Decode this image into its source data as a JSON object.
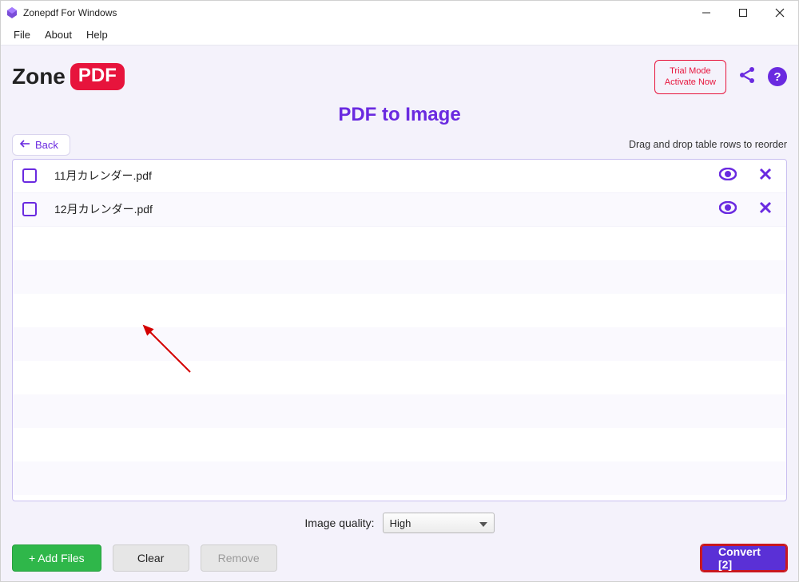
{
  "window": {
    "title": "Zonepdf For Windows"
  },
  "menubar": {
    "file": "File",
    "about": "About",
    "help": "Help"
  },
  "logo": {
    "text": "Zone",
    "badge": "PDF"
  },
  "trial": {
    "line1": "Trial Mode",
    "line2": "Activate Now"
  },
  "page": {
    "title": "PDF to Image"
  },
  "back": {
    "label": "Back"
  },
  "hint": "Drag and drop table rows to reorder",
  "files": [
    {
      "name": "11月カレンダー.pdf"
    },
    {
      "name": "12月カレンダー.pdf"
    }
  ],
  "quality": {
    "label": "Image quality:",
    "value": "High"
  },
  "buttons": {
    "add": "+ Add Files",
    "clear": "Clear",
    "remove": "Remove",
    "convert": "Convert [2]"
  }
}
